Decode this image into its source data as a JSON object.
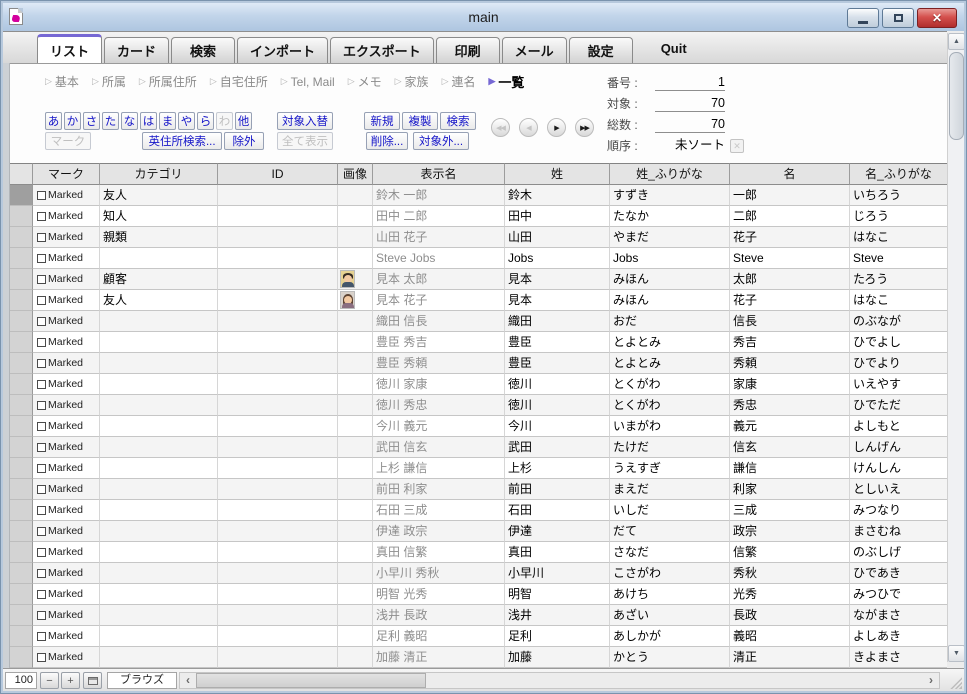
{
  "colors": {
    "titlebar_blue": "#bcd2e8",
    "accent_purple": "#7668d4",
    "button_text_blue": "#1414c8",
    "close_button_red": "#c8393d",
    "table_header_gray": "#e4e4e4"
  },
  "window": {
    "title": "main"
  },
  "tabs": {
    "items": [
      "リスト",
      "カード",
      "検索",
      "インポート",
      "エクスポート",
      "印刷",
      "メール",
      "設定"
    ],
    "active_index": 0,
    "quit_label": "Quit"
  },
  "subtabs": {
    "items": [
      "基本",
      "所属",
      "所属住所",
      "自宅住所",
      "Tel, Mail",
      "メモ",
      "家族",
      "連名",
      "一覧"
    ],
    "active_index": 8
  },
  "filter_bar": {
    "kana_buttons": [
      {
        "label": "あ",
        "enabled": true
      },
      {
        "label": "か",
        "enabled": true
      },
      {
        "label": "さ",
        "enabled": true
      },
      {
        "label": "た",
        "enabled": true
      },
      {
        "label": "な",
        "enabled": true
      },
      {
        "label": "は",
        "enabled": true
      },
      {
        "label": "ま",
        "enabled": true
      },
      {
        "label": "や",
        "enabled": true
      },
      {
        "label": "ら",
        "enabled": true
      },
      {
        "label": "わ",
        "enabled": false
      },
      {
        "label": "他",
        "enabled": true
      }
    ],
    "buttons": {
      "mark": {
        "label": "マーク",
        "enabled": false
      },
      "en_address_search": {
        "label": "英住所検索...",
        "enabled": true
      },
      "omit_one": {
        "label": "除外",
        "enabled": true
      },
      "swap_found": {
        "label": "対象入替",
        "enabled": true
      },
      "show_all": {
        "label": "全て表示",
        "enabled": false
      },
      "new": {
        "label": "新規",
        "enabled": true
      },
      "duplicate": {
        "label": "複製",
        "enabled": true
      },
      "find": {
        "label": "検索",
        "enabled": true
      },
      "delete": {
        "label": "削除...",
        "enabled": true
      },
      "omit_multiple": {
        "label": "対象外...",
        "enabled": true
      }
    }
  },
  "nav_buttons": [
    {
      "name": "first-record-button",
      "glyph": "◀◀",
      "enabled": false
    },
    {
      "name": "previous-record-button",
      "glyph": "◀",
      "enabled": false
    },
    {
      "name": "next-record-button",
      "glyph": "▶",
      "enabled": true
    },
    {
      "name": "last-record-button",
      "glyph": "▶▶",
      "enabled": true
    }
  ],
  "record_info": {
    "fields": [
      {
        "label": "番号 :",
        "value": "1",
        "underline": true,
        "clear_button": false
      },
      {
        "label": "対象 :",
        "value": "70",
        "underline": true,
        "clear_button": false
      },
      {
        "label": "総数 :",
        "value": "70",
        "underline": true,
        "clear_button": false
      },
      {
        "label": "順序 :",
        "value": "未ソート",
        "underline": false,
        "clear_button": true
      }
    ]
  },
  "table": {
    "columns": [
      "マーク",
      "カテゴリ",
      "ID",
      "画像",
      "表示名",
      "姓",
      "姓_ふりがな",
      "名",
      "名_ふりがな"
    ],
    "mark_label": "Marked",
    "rows": [
      {
        "current": true,
        "category": "友人",
        "id": "",
        "photo": "",
        "display": "鈴木 一郎",
        "sei": "鈴木",
        "sei_kana": "すずき",
        "mei": "一郎",
        "mei_kana": "いちろう"
      },
      {
        "current": false,
        "category": "知人",
        "id": "",
        "photo": "",
        "display": "田中 二郎",
        "sei": "田中",
        "sei_kana": "たなか",
        "mei": "二郎",
        "mei_kana": "じろう"
      },
      {
        "current": false,
        "category": "親類",
        "id": "",
        "photo": "",
        "display": "山田 花子",
        "sei": "山田",
        "sei_kana": "やまだ",
        "mei": "花子",
        "mei_kana": "はなこ"
      },
      {
        "current": false,
        "category": "",
        "id": "",
        "photo": "",
        "display": "Steve Jobs",
        "sei": "Jobs",
        "sei_kana": "Jobs",
        "mei": "Steve",
        "mei_kana": "Steve"
      },
      {
        "current": false,
        "category": "顧客",
        "id": "",
        "photo": "male",
        "display": "見本 太郎",
        "sei": "見本",
        "sei_kana": "みほん",
        "mei": "太郎",
        "mei_kana": "たろう"
      },
      {
        "current": false,
        "category": "友人",
        "id": "",
        "photo": "female",
        "display": "見本 花子",
        "sei": "見本",
        "sei_kana": "みほん",
        "mei": "花子",
        "mei_kana": "はなこ"
      },
      {
        "current": false,
        "category": "",
        "id": "",
        "photo": "",
        "display": "織田 信長",
        "sei": "織田",
        "sei_kana": "おだ",
        "mei": "信長",
        "mei_kana": "のぶなが"
      },
      {
        "current": false,
        "category": "",
        "id": "",
        "photo": "",
        "display": "豊臣 秀吉",
        "sei": "豊臣",
        "sei_kana": "とよとみ",
        "mei": "秀吉",
        "mei_kana": "ひでよし"
      },
      {
        "current": false,
        "category": "",
        "id": "",
        "photo": "",
        "display": "豊臣 秀頼",
        "sei": "豊臣",
        "sei_kana": "とよとみ",
        "mei": "秀頼",
        "mei_kana": "ひでより"
      },
      {
        "current": false,
        "category": "",
        "id": "",
        "photo": "",
        "display": "徳川 家康",
        "sei": "徳川",
        "sei_kana": "とくがわ",
        "mei": "家康",
        "mei_kana": "いえやす"
      },
      {
        "current": false,
        "category": "",
        "id": "",
        "photo": "",
        "display": "徳川 秀忠",
        "sei": "徳川",
        "sei_kana": "とくがわ",
        "mei": "秀忠",
        "mei_kana": "ひでただ"
      },
      {
        "current": false,
        "category": "",
        "id": "",
        "photo": "",
        "display": "今川 義元",
        "sei": "今川",
        "sei_kana": "いまがわ",
        "mei": "義元",
        "mei_kana": "よしもと"
      },
      {
        "current": false,
        "category": "",
        "id": "",
        "photo": "",
        "display": "武田 信玄",
        "sei": "武田",
        "sei_kana": "たけだ",
        "mei": "信玄",
        "mei_kana": "しんげん"
      },
      {
        "current": false,
        "category": "",
        "id": "",
        "photo": "",
        "display": "上杉 謙信",
        "sei": "上杉",
        "sei_kana": "うえすぎ",
        "mei": "謙信",
        "mei_kana": "けんしん"
      },
      {
        "current": false,
        "category": "",
        "id": "",
        "photo": "",
        "display": "前田 利家",
        "sei": "前田",
        "sei_kana": "まえだ",
        "mei": "利家",
        "mei_kana": "としいえ"
      },
      {
        "current": false,
        "category": "",
        "id": "",
        "photo": "",
        "display": "石田 三成",
        "sei": "石田",
        "sei_kana": "いしだ",
        "mei": "三成",
        "mei_kana": "みつなり"
      },
      {
        "current": false,
        "category": "",
        "id": "",
        "photo": "",
        "display": "伊達 政宗",
        "sei": "伊達",
        "sei_kana": "だて",
        "mei": "政宗",
        "mei_kana": "まさむね"
      },
      {
        "current": false,
        "category": "",
        "id": "",
        "photo": "",
        "display": "真田 信繁",
        "sei": "真田",
        "sei_kana": "さなだ",
        "mei": "信繁",
        "mei_kana": "のぶしげ"
      },
      {
        "current": false,
        "category": "",
        "id": "",
        "photo": "",
        "display": "小早川 秀秋",
        "sei": "小早川",
        "sei_kana": "こさがわ",
        "mei": "秀秋",
        "mei_kana": "ひであき"
      },
      {
        "current": false,
        "category": "",
        "id": "",
        "photo": "",
        "display": "明智 光秀",
        "sei": "明智",
        "sei_kana": "あけち",
        "mei": "光秀",
        "mei_kana": "みつひで"
      },
      {
        "current": false,
        "category": "",
        "id": "",
        "photo": "",
        "display": "浅井 長政",
        "sei": "浅井",
        "sei_kana": "あざい",
        "mei": "長政",
        "mei_kana": "ながまさ"
      },
      {
        "current": false,
        "category": "",
        "id": "",
        "photo": "",
        "display": "足利 義昭",
        "sei": "足利",
        "sei_kana": "あしかが",
        "mei": "義昭",
        "mei_kana": "よしあき"
      },
      {
        "current": false,
        "category": "",
        "id": "",
        "photo": "",
        "display": "加藤 清正",
        "sei": "加藤",
        "sei_kana": "かとう",
        "mei": "清正",
        "mei_kana": "きよまさ"
      }
    ]
  },
  "statusbar": {
    "zoom_value": "100",
    "mode": "ブラウズ"
  }
}
